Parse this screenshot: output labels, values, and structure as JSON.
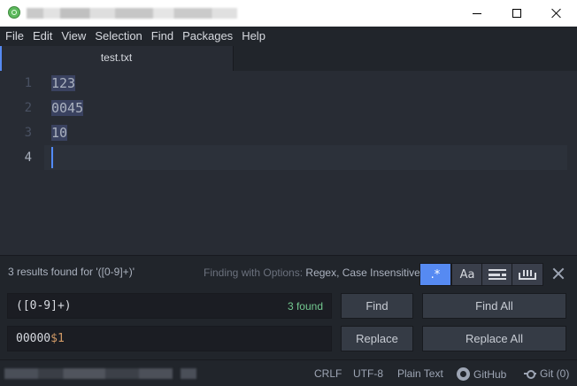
{
  "menu": [
    "File",
    "Edit",
    "View",
    "Selection",
    "Find",
    "Packages",
    "Help"
  ],
  "tab": {
    "label": "test.txt"
  },
  "editor": {
    "line_numbers": [
      "1",
      "2",
      "3",
      "4"
    ],
    "lines": [
      "123",
      "0045",
      "10",
      ""
    ]
  },
  "find": {
    "results_text": "3 results found for '([0-9]+)'",
    "options_prefix": "Finding with Options:",
    "options_value": "Regex, Case Insensitive",
    "regex_label": ".*",
    "case_label": "Aa",
    "find_value": "([0-9]+)",
    "found_count": "3 found",
    "replace_prefix": "00000",
    "replace_var": "$1",
    "find_button": "Find",
    "find_all_button": "Find All",
    "replace_button": "Replace",
    "replace_all_button": "Replace All"
  },
  "status": {
    "line_ending": "CRLF",
    "encoding": "UTF-8",
    "grammar": "Plain Text",
    "github": "GitHub",
    "git": "Git (0)"
  },
  "colors": {
    "accent": "#568af2",
    "found": "#73c990"
  }
}
